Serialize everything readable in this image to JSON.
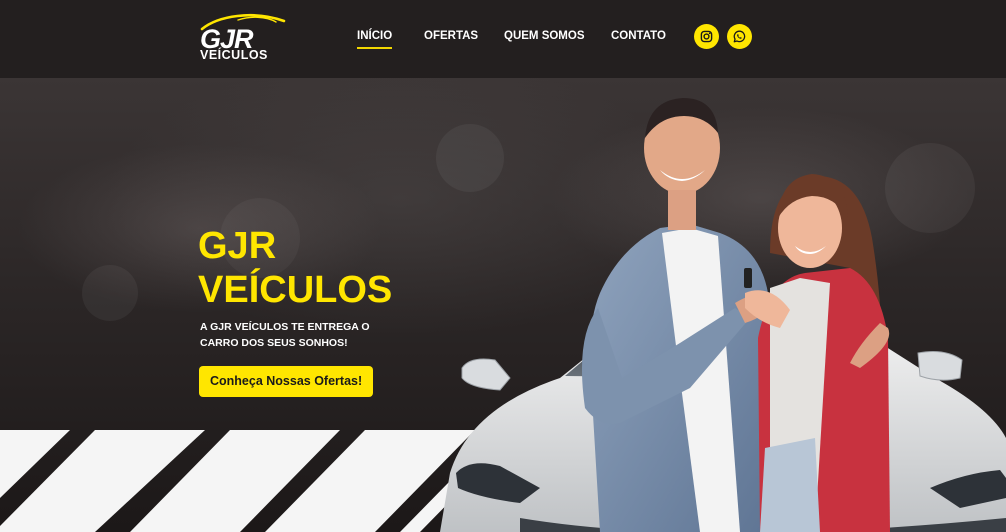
{
  "brand": {
    "logo_main": "GJR",
    "logo_sub": "VEÍCULOS",
    "accent_color": "#ffe600",
    "header_bg": "#231f1f"
  },
  "nav": {
    "items": [
      {
        "label": "INÍCIO",
        "active": true
      },
      {
        "label": "OFERTAS",
        "active": false
      },
      {
        "label": "QUEM SOMOS",
        "active": false
      },
      {
        "label": "CONTATO",
        "active": false
      }
    ],
    "social": [
      {
        "icon": "instagram-icon"
      },
      {
        "icon": "whatsapp-icon"
      }
    ]
  },
  "hero": {
    "title_line1": "GJR",
    "title_line2": "VEÍCULOS",
    "subtitle_line1": "A GJR VEÍCULOS TE ENTREGA O",
    "subtitle_line2": "CARRO DOS SEUS SONHOS!",
    "cta_label": "Conheça Nossas Ofertas!",
    "image": "couple-with-car-keys-photo"
  }
}
